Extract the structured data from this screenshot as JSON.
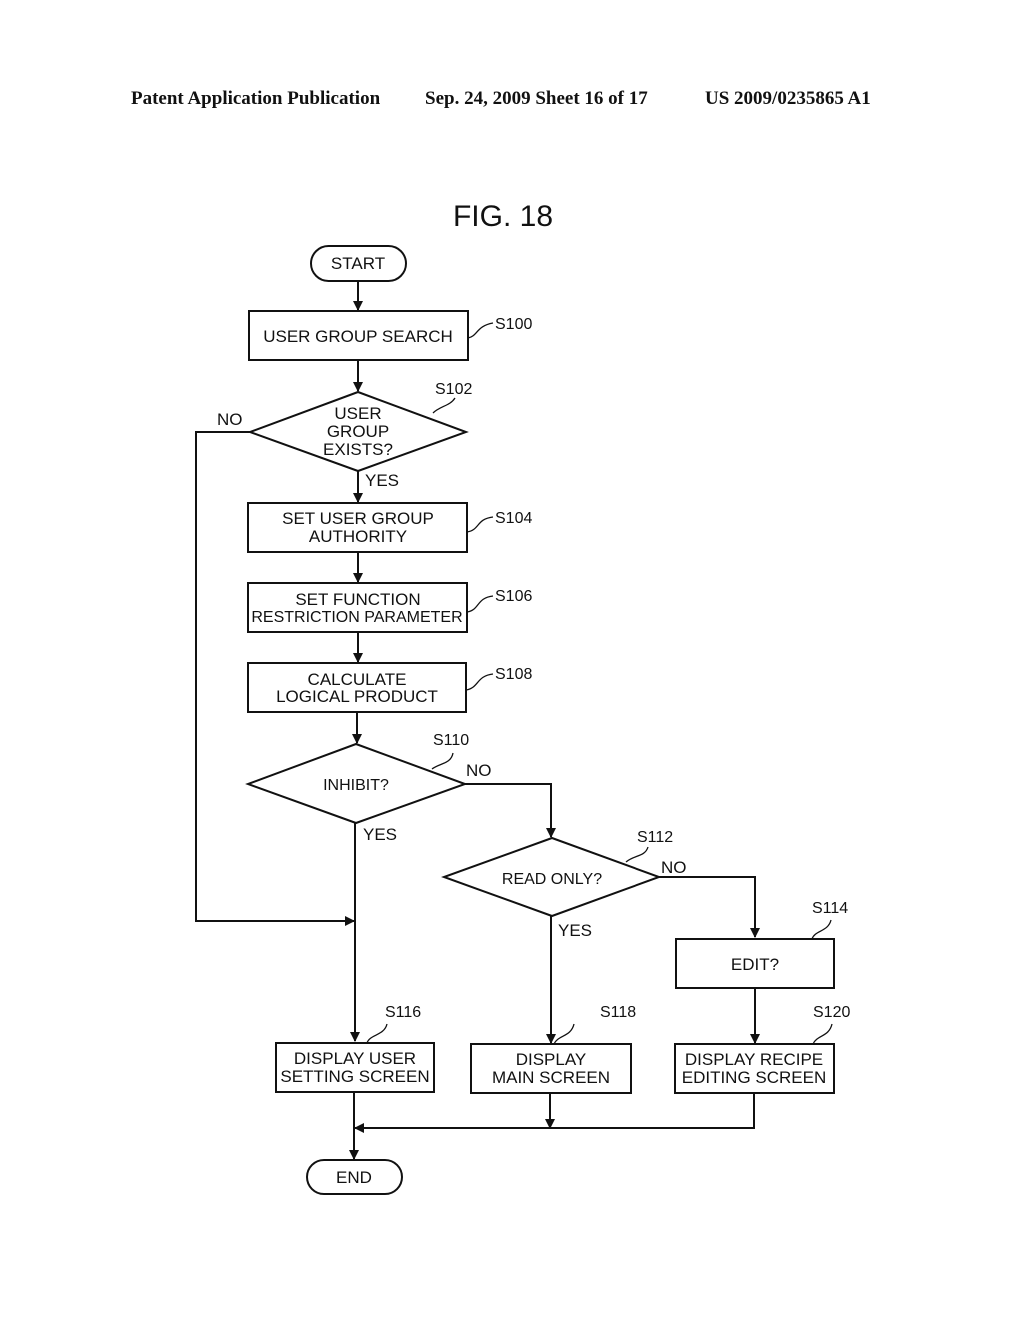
{
  "header": {
    "publication": "Patent Application Publication",
    "date_sheet": "Sep. 24, 2009   Sheet 16 of 17",
    "number": "US 2009/0235865 A1"
  },
  "figure": {
    "title": "FIG. 18",
    "nodes": {
      "start": {
        "text": [
          "START"
        ]
      },
      "s100": {
        "step": "S100",
        "text": [
          "USER GROUP SEARCH"
        ]
      },
      "s102": {
        "step": "S102",
        "text": [
          "USER",
          "GROUP",
          "EXISTS?"
        ]
      },
      "s104": {
        "step": "S104",
        "text": [
          "SET USER GROUP",
          "AUTHORITY"
        ]
      },
      "s106": {
        "step": "S106",
        "text": [
          "SET FUNCTION",
          "RESTRICTION PARAMETER"
        ]
      },
      "s108": {
        "step": "S108",
        "text": [
          "CALCULATE",
          "LOGICAL PRODUCT"
        ]
      },
      "s110": {
        "step": "S110",
        "text": [
          "INHIBIT?"
        ]
      },
      "s112": {
        "step": "S112",
        "text": [
          "READ ONLY?"
        ]
      },
      "s114": {
        "step": "S114",
        "text": [
          "EDIT?"
        ]
      },
      "s116": {
        "step": "S116",
        "text": [
          "DISPLAY USER",
          "SETTING SCREEN"
        ]
      },
      "s118": {
        "step": "S118",
        "text": [
          "DISPLAY",
          "MAIN SCREEN"
        ]
      },
      "s120": {
        "step": "S120",
        "text": [
          "DISPLAY RECIPE",
          "EDITING SCREEN"
        ]
      },
      "end": {
        "text": [
          "END"
        ]
      }
    },
    "edge_labels": {
      "s102_no": "NO",
      "s102_yes": "YES",
      "s110_no": "NO",
      "s110_yes": "YES",
      "s112_no": "NO",
      "s112_yes": "YES"
    }
  }
}
